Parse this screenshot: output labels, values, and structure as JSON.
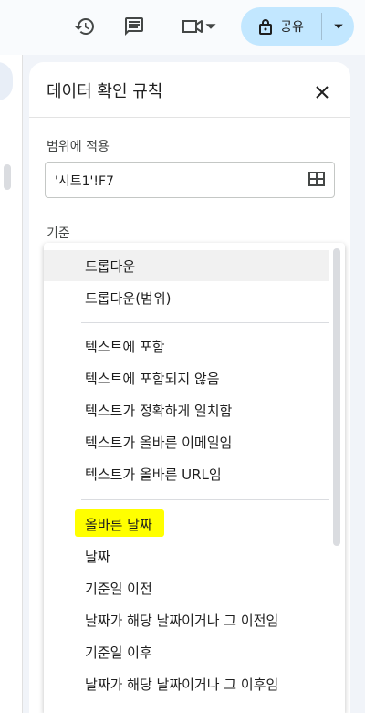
{
  "toolbar": {
    "history_icon": "history-icon",
    "comment_icon": "comment-icon",
    "meet_icon": "video-camera-icon",
    "share_label": "공유",
    "share_icon": "lock-icon"
  },
  "panel": {
    "title": "데이터 확인 규칙",
    "apply_label": "범위에 적용",
    "range_value": "'시트1'!F7",
    "criteria_label": "기준"
  },
  "menu": {
    "items": [
      "드롭다운",
      "드롭다운(범위)",
      "텍스트에 포함",
      "텍스트에 포함되지 않음",
      "텍스트가 정확하게 일치함",
      "텍스트가 올바른 이메일임",
      "텍스트가 올바른 URL임",
      "올바른 날짜",
      "날짜",
      "기준일 이전",
      "날짜가 해당 날짜이거나 그 이전임",
      "기준일 이후",
      "날짜가 해당 날짜이거나 그 이후임"
    ]
  },
  "colors": {
    "share_bg": "#c2e7ff",
    "highlight": "#ffff00"
  }
}
